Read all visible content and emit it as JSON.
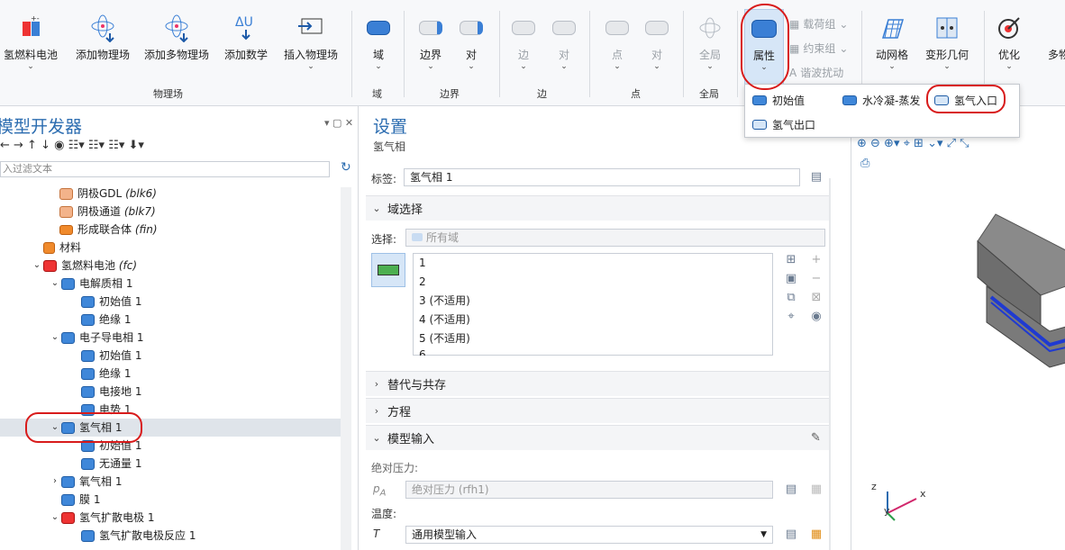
{
  "ribbon": {
    "buttons": [
      {
        "label": "氢燃料电池",
        "key": "fc"
      },
      {
        "label": "添加物理场",
        "key": "add_phys"
      },
      {
        "label": "添加多物理场",
        "key": "add_multi"
      },
      {
        "label": "添加数学",
        "key": "add_math"
      },
      {
        "label": "插入物理场",
        "key": "insert_phys"
      },
      {
        "label": "域"
      },
      {
        "label": "边界"
      },
      {
        "label": "对"
      },
      {
        "label": "边"
      },
      {
        "label": "对"
      },
      {
        "label": "点"
      },
      {
        "label": "对"
      },
      {
        "label": "全局"
      },
      {
        "label": "属性"
      },
      {
        "label": "动网格"
      },
      {
        "label": "变形几何"
      },
      {
        "label": "优化"
      },
      {
        "label": "多物"
      }
    ],
    "groups": [
      "物理场",
      "域",
      "边界",
      "边",
      "点",
      "全局"
    ],
    "small_items": [
      "载荷组",
      "约束组",
      "谐波扰动"
    ],
    "dropdown": [
      "初始值",
      "水冷凝-蒸发",
      "氢气入口",
      "氢气出口"
    ]
  },
  "model_dev": {
    "title": "模型开发器",
    "filter_placeholder": "入过滤文本",
    "tree": [
      {
        "label": "阴极GDL",
        "tag": "(blk6)"
      },
      {
        "label": "阴极通道",
        "tag": "(blk7)"
      },
      {
        "label": "形成联合体",
        "tag": "(fin)"
      },
      {
        "label": "材料",
        "tag": ""
      },
      {
        "label": "氢燃料电池",
        "tag": "(fc)"
      },
      {
        "label": "电解质相 1",
        "tag": ""
      },
      {
        "label": "初始值 1",
        "tag": ""
      },
      {
        "label": "绝缘 1",
        "tag": ""
      },
      {
        "label": "电子导电相 1",
        "tag": ""
      },
      {
        "label": "初始值 1",
        "tag": ""
      },
      {
        "label": "绝缘 1",
        "tag": ""
      },
      {
        "label": "电接地 1",
        "tag": ""
      },
      {
        "label": "电势 1",
        "tag": ""
      },
      {
        "label": "氢气相 1",
        "tag": ""
      },
      {
        "label": "初始值 1",
        "tag": ""
      },
      {
        "label": "无通量 1",
        "tag": ""
      },
      {
        "label": "氧气相 1",
        "tag": ""
      },
      {
        "label": "膜 1",
        "tag": ""
      },
      {
        "label": "氢气扩散电极 1",
        "tag": ""
      },
      {
        "label": "氢气扩散电极反应 1",
        "tag": ""
      }
    ]
  },
  "settings": {
    "title": "设置",
    "subtitle": "氢气相",
    "label_caption": "标签:",
    "label_value": "氢气相 1",
    "domain_section": "域选择",
    "selection_caption": "选择:",
    "selection_value": "所有域",
    "domains": [
      "1",
      "2",
      "3 (不适用)",
      "4 (不适用)",
      "5 (不适用)",
      "6"
    ],
    "sec_override": "替代与共存",
    "sec_equation": "方程",
    "sec_model_input": "模型输入",
    "abs_pressure_caption": "绝对压力:",
    "pa_symbol": "p",
    "pa_sub": "A",
    "abs_pressure_value": "绝对压力 (rfh1)",
    "temp_caption": "温度:",
    "temp_symbol": "T",
    "temp_value": "通用模型输入"
  },
  "graphics": {
    "axis_x": "x",
    "axis_y": "y",
    "axis_z": "z"
  }
}
